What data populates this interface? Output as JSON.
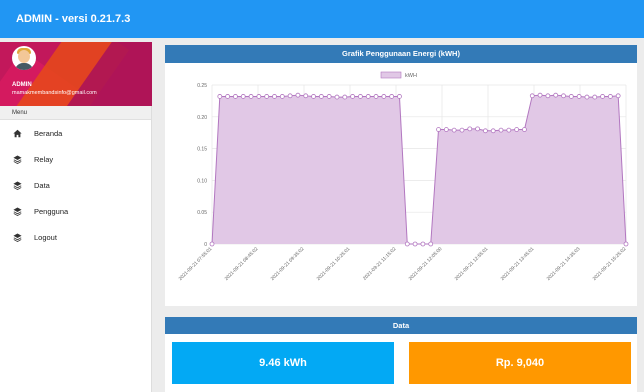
{
  "app": {
    "title": "ADMIN - versi 0.21.7.3"
  },
  "profile": {
    "name": "ADMIN",
    "email": "mamakmembandsinfo@gmail.com"
  },
  "sidebar": {
    "menu_label": "Menu",
    "items": [
      {
        "label": "Beranda",
        "icon": "home-icon"
      },
      {
        "label": "Relay",
        "icon": "layers-icon"
      },
      {
        "label": "Data",
        "icon": "layers-icon"
      },
      {
        "label": "Pengguna",
        "icon": "layers-icon"
      },
      {
        "label": "Logout",
        "icon": "layers-icon"
      }
    ]
  },
  "chart_panel": {
    "title": "Grafik Penggunaan Energi (kWH)"
  },
  "data_panel": {
    "title": "Data",
    "energy_value": "9.46 kWh",
    "cost_value": "Rp. 9,040"
  },
  "colors": {
    "topbar": "#2196f3",
    "panel_header": "#337ab7",
    "card_energy": "#03a9f4",
    "card_cost": "#ff9800",
    "series_fill": "#e1c8e6",
    "series_line": "#b277c0"
  },
  "chart_data": {
    "type": "area",
    "title": "",
    "xlabel": "",
    "ylabel": "",
    "ylim": [
      0,
      0.25
    ],
    "yticks": [
      "0",
      "0.05",
      "0.10",
      "0.15",
      "0.20",
      "0.25"
    ],
    "grid": true,
    "legend_position": "top-center",
    "x_tick_labels": [
      "2021-09-21 07:55:01",
      "2021-09-21 08:45:02",
      "2021-09-21 09:35:02",
      "2021-09-21 10:25:01",
      "2021-09-21 11:15:02",
      "2021-09-21 12:05:00",
      "2021-09-21 12:55:01",
      "2021-09-21 13:45:01",
      "2021-09-21 14:35:03",
      "2021-09-21 15:25:02"
    ],
    "series": [
      {
        "name": "kWH",
        "values": [
          0,
          0.232,
          0.232,
          0.232,
          0.232,
          0.232,
          0.232,
          0.232,
          0.232,
          0.232,
          0.233,
          0.234,
          0.233,
          0.232,
          0.232,
          0.232,
          0.231,
          0.231,
          0.232,
          0.232,
          0.232,
          0.232,
          0.232,
          0.232,
          0.232,
          0,
          0,
          0,
          0,
          0.18,
          0.18,
          0.179,
          0.179,
          0.181,
          0.181,
          0.178,
          0.178,
          0.179,
          0.179,
          0.18,
          0.18,
          0.233,
          0.234,
          0.233,
          0.234,
          0.233,
          0.232,
          0.232,
          0.231,
          0.231,
          0.232,
          0.232,
          0.233,
          0
        ]
      }
    ]
  }
}
